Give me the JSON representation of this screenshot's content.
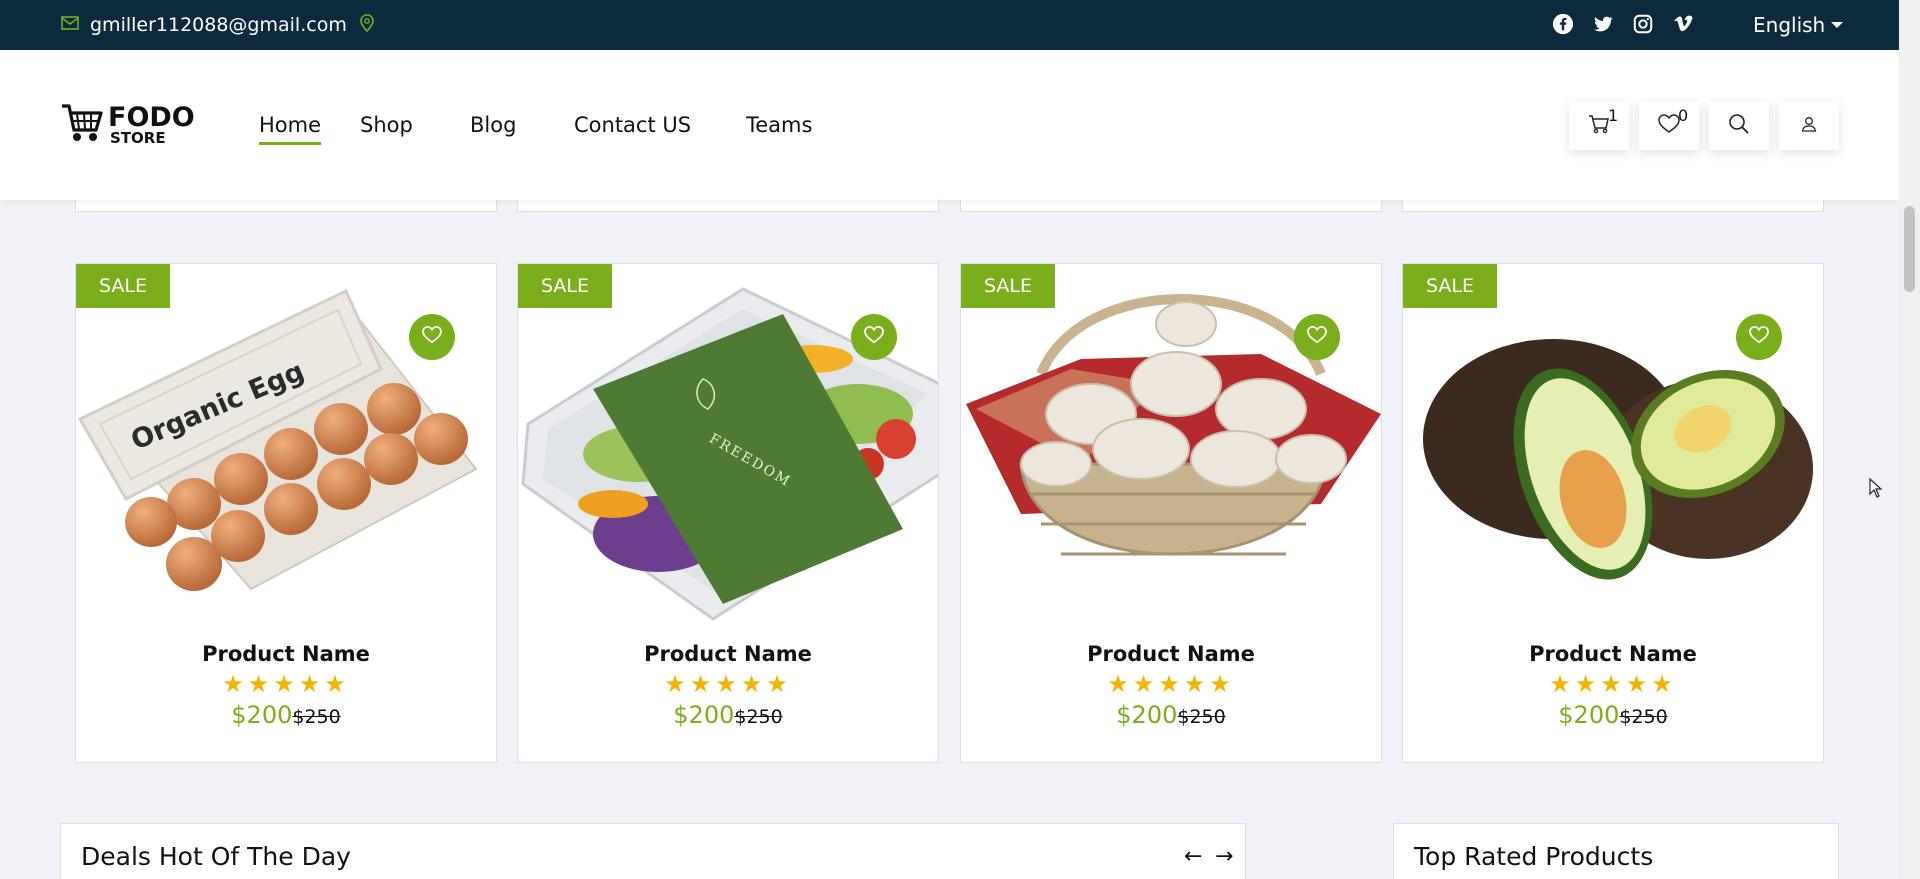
{
  "topbar": {
    "email": "gmiller112088@gmail.com",
    "language": "English",
    "social_icons": [
      "facebook-icon",
      "twitter-icon",
      "instagram-icon",
      "vimeo-icon"
    ]
  },
  "brand": {
    "logo_line1": "FODO",
    "logo_line2": "STORE"
  },
  "nav": {
    "items": [
      {
        "label": "Home",
        "active": true
      },
      {
        "label": "Shop",
        "active": false
      },
      {
        "label": "Blog",
        "active": false
      },
      {
        "label": "Contact US",
        "active": false
      },
      {
        "label": "Teams",
        "active": false
      }
    ]
  },
  "header_actions": {
    "cart_count": "1",
    "wishlist_count": "0"
  },
  "products": [
    {
      "badge": "SALE",
      "name": "Product Name",
      "rating": 5,
      "price": "$200",
      "old_price": "$250",
      "image": "organic-egg-carton"
    },
    {
      "badge": "SALE",
      "name": "Product Name",
      "rating": 5,
      "price": "$200",
      "old_price": "$250",
      "image": "salad-box"
    },
    {
      "badge": "SALE",
      "name": "Product Name",
      "rating": 5,
      "price": "$200",
      "old_price": "$250",
      "image": "mushroom-basket"
    },
    {
      "badge": "SALE",
      "name": "Product Name",
      "rating": 5,
      "price": "$200",
      "old_price": "$250",
      "image": "avocado"
    }
  ],
  "egg_label": "Organic Egg",
  "salad_label": "FREEDOM",
  "sections": {
    "deals_title": "Deals Hot Of The Day",
    "top_rated_title": "Top Rated Products"
  },
  "colors": {
    "accent": "#7aae1a",
    "topbar": "#0c2a3d",
    "star": "#f4b400",
    "page_bg": "#f1f2f7"
  }
}
